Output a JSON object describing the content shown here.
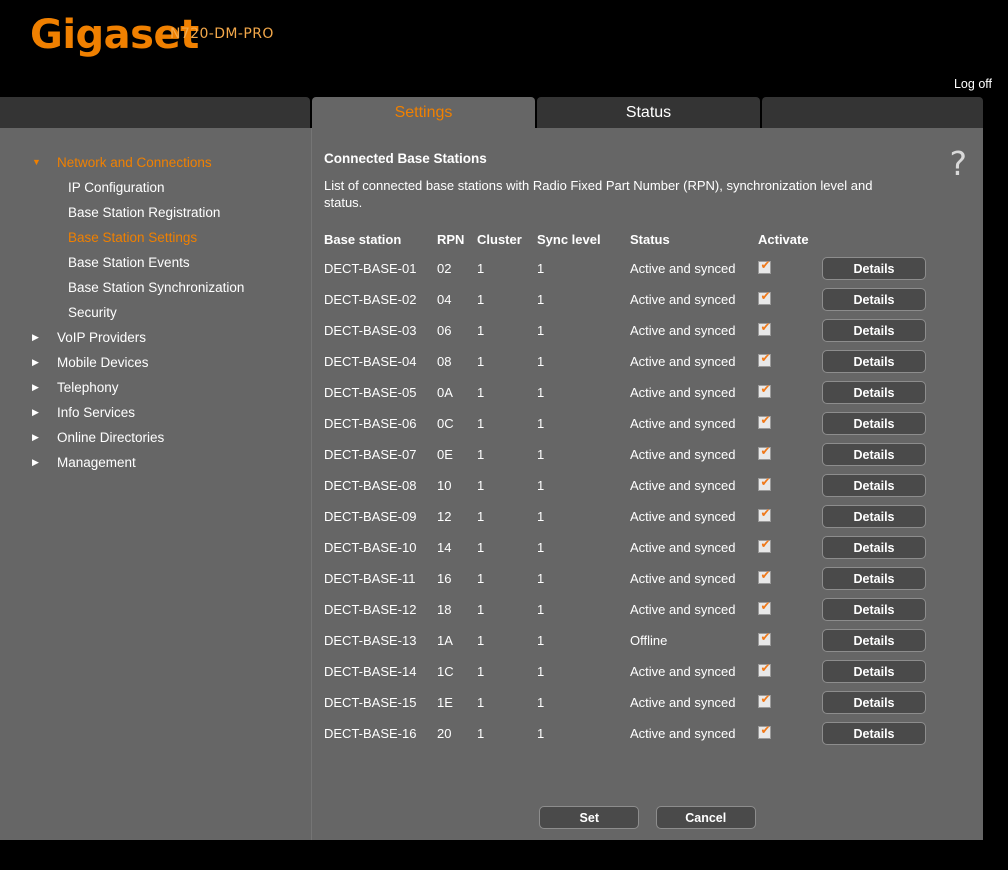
{
  "brand": {
    "logo": "Gigaset",
    "model": "N720-DM-PRO",
    "logoff_label": "Log off",
    "accent_color": "#f08000"
  },
  "tabs": [
    {
      "label": "Settings",
      "active": true
    },
    {
      "label": "Status",
      "active": false
    },
    {
      "label": "",
      "active": false
    }
  ],
  "sidebar": {
    "items": [
      {
        "label": "Network and Connections",
        "level": "top",
        "expanded": true,
        "selected": false
      },
      {
        "label": "IP Configuration",
        "level": "child",
        "selected": false
      },
      {
        "label": "Base Station Registration",
        "level": "child",
        "selected": false
      },
      {
        "label": "Base Station Settings",
        "level": "child",
        "selected": true
      },
      {
        "label": "Base Station Events",
        "level": "child",
        "selected": false
      },
      {
        "label": "Base Station Synchronization",
        "level": "child",
        "selected": false
      },
      {
        "label": "Security",
        "level": "child",
        "selected": false
      },
      {
        "label": "VoIP Providers",
        "level": "top",
        "expanded": false,
        "selected": false
      },
      {
        "label": "Mobile Devices",
        "level": "top",
        "expanded": false,
        "selected": false
      },
      {
        "label": "Telephony",
        "level": "top",
        "expanded": false,
        "selected": false
      },
      {
        "label": "Info Services",
        "level": "top",
        "expanded": false,
        "selected": false
      },
      {
        "label": "Online Directories",
        "level": "top",
        "expanded": false,
        "selected": false
      },
      {
        "label": "Management",
        "level": "top",
        "expanded": false,
        "selected": false
      }
    ]
  },
  "content": {
    "title": "Connected Base Stations",
    "description": "List of connected base stations with Radio Fixed Part Number (RPN), synchronization level and status.",
    "help_icon": "question-mark-icon",
    "table": {
      "columns": [
        "Base station",
        "RPN",
        "Cluster",
        "Sync level",
        "Status",
        "Activate",
        ""
      ],
      "details_label": "Details",
      "rows": [
        {
          "name": "DECT-BASE-01",
          "rpn": "02",
          "cluster": "1",
          "sync_level": "1",
          "status": "Active and synced",
          "activate": true
        },
        {
          "name": "DECT-BASE-02",
          "rpn": "04",
          "cluster": "1",
          "sync_level": "1",
          "status": "Active and synced",
          "activate": true
        },
        {
          "name": "DECT-BASE-03",
          "rpn": "06",
          "cluster": "1",
          "sync_level": "1",
          "status": "Active and synced",
          "activate": true
        },
        {
          "name": "DECT-BASE-04",
          "rpn": "08",
          "cluster": "1",
          "sync_level": "1",
          "status": "Active and synced",
          "activate": true
        },
        {
          "name": "DECT-BASE-05",
          "rpn": "0A",
          "cluster": "1",
          "sync_level": "1",
          "status": "Active and synced",
          "activate": true
        },
        {
          "name": "DECT-BASE-06",
          "rpn": "0C",
          "cluster": "1",
          "sync_level": "1",
          "status": "Active and synced",
          "activate": true
        },
        {
          "name": "DECT-BASE-07",
          "rpn": "0E",
          "cluster": "1",
          "sync_level": "1",
          "status": "Active and synced",
          "activate": true
        },
        {
          "name": "DECT-BASE-08",
          "rpn": "10",
          "cluster": "1",
          "sync_level": "1",
          "status": "Active and synced",
          "activate": true
        },
        {
          "name": "DECT-BASE-09",
          "rpn": "12",
          "cluster": "1",
          "sync_level": "1",
          "status": "Active and synced",
          "activate": true
        },
        {
          "name": "DECT-BASE-10",
          "rpn": "14",
          "cluster": "1",
          "sync_level": "1",
          "status": "Active and synced",
          "activate": true
        },
        {
          "name": "DECT-BASE-11",
          "rpn": "16",
          "cluster": "1",
          "sync_level": "1",
          "status": "Active and synced",
          "activate": true
        },
        {
          "name": "DECT-BASE-12",
          "rpn": "18",
          "cluster": "1",
          "sync_level": "1",
          "status": "Active and synced",
          "activate": true
        },
        {
          "name": "DECT-BASE-13",
          "rpn": "1A",
          "cluster": "1",
          "sync_level": "1",
          "status": "Offline",
          "activate": true
        },
        {
          "name": "DECT-BASE-14",
          "rpn": "1C",
          "cluster": "1",
          "sync_level": "1",
          "status": "Active and synced",
          "activate": true
        },
        {
          "name": "DECT-BASE-15",
          "rpn": "1E",
          "cluster": "1",
          "sync_level": "1",
          "status": "Active and synced",
          "activate": true
        },
        {
          "name": "DECT-BASE-16",
          "rpn": "20",
          "cluster": "1",
          "sync_level": "1",
          "status": "Active and synced",
          "activate": true
        }
      ]
    },
    "footer": {
      "set_label": "Set",
      "cancel_label": "Cancel"
    }
  }
}
